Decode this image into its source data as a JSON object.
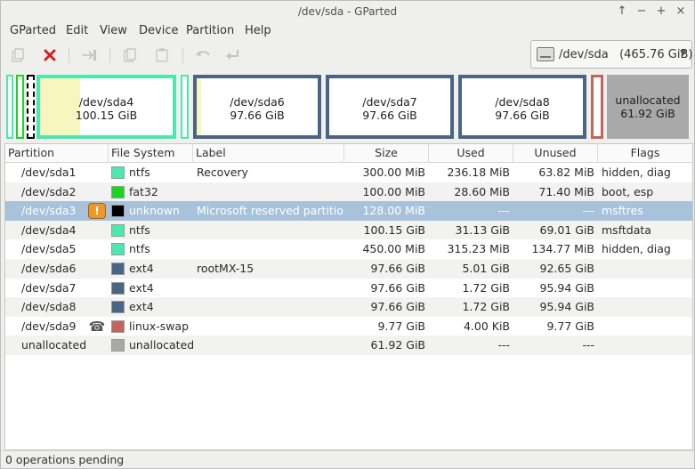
{
  "window": {
    "title": "/dev/sda - GParted"
  },
  "menu": [
    "GParted",
    "Edit",
    "View",
    "Device",
    "Partition",
    "Help"
  ],
  "toolbar": {
    "icons": [
      "new-icon",
      "delete-icon",
      "resize-move-icon",
      "copy-icon",
      "paste-icon",
      "undo-icon",
      "apply-icon"
    ]
  },
  "device_selector": {
    "label": "/dev/sda   (465.76 GiB)"
  },
  "disk_map": {
    "segments": [
      {
        "id": "sda1",
        "color": "#4ce8b0"
      },
      {
        "id": "sda2",
        "color": "#16d620"
      },
      {
        "id": "sda3",
        "color": "#000000"
      },
      {
        "id": "sda4",
        "name": "/dev/sda4",
        "size": "100.15 GiB",
        "color": "#4ce8b0"
      },
      {
        "id": "sda5",
        "color": "#4ce8b0"
      },
      {
        "id": "sda6",
        "name": "/dev/sda6",
        "size": "97.66 GiB",
        "color": "#4a6584"
      },
      {
        "id": "sda7",
        "name": "/dev/sda7",
        "size": "97.66 GiB",
        "color": "#4a6584"
      },
      {
        "id": "sda8",
        "name": "/dev/sda8",
        "size": "97.66 GiB",
        "color": "#4a6584"
      },
      {
        "id": "sda9",
        "color": "#c1665a"
      },
      {
        "id": "unallocated",
        "name": "unallocated",
        "size": "61.92 GiB",
        "color": "#a9a9a9"
      }
    ]
  },
  "table": {
    "columns": [
      "Partition",
      "File System",
      "Label",
      "Size",
      "Used",
      "Unused",
      "Flags"
    ],
    "rows": [
      {
        "partition": "/dev/sda1",
        "fs": "ntfs",
        "fs_color": "#4ce8b0",
        "label": "Recovery",
        "size": "300.00 MiB",
        "used": "236.18 MiB",
        "unused": "63.82 MiB",
        "flags": "hidden, diag"
      },
      {
        "partition": "/dev/sda2",
        "fs": "fat32",
        "fs_color": "#16d620",
        "label": "",
        "size": "100.00 MiB",
        "used": "28.60 MiB",
        "unused": "71.40 MiB",
        "flags": "boot, esp"
      },
      {
        "partition": "/dev/sda3",
        "fs": "unknown",
        "fs_color": "#000000",
        "label": "Microsoft reserved partition",
        "size": "128.00 MiB",
        "used": "---",
        "unused": "---",
        "flags": "msftres",
        "icon": "warning-icon"
      },
      {
        "partition": "/dev/sda4",
        "fs": "ntfs",
        "fs_color": "#4ce8b0",
        "label": "",
        "size": "100.15 GiB",
        "used": "31.13 GiB",
        "unused": "69.01 GiB",
        "flags": "msftdata"
      },
      {
        "partition": "/dev/sda5",
        "fs": "ntfs",
        "fs_color": "#4ce8b0",
        "label": "",
        "size": "450.00 MiB",
        "used": "315.23 MiB",
        "unused": "134.77 MiB",
        "flags": "hidden, diag"
      },
      {
        "partition": "/dev/sda6",
        "fs": "ext4",
        "fs_color": "#4a6584",
        "label": "rootMX-15",
        "size": "97.66 GiB",
        "used": "5.01 GiB",
        "unused": "92.65 GiB",
        "flags": ""
      },
      {
        "partition": "/dev/sda7",
        "fs": "ext4",
        "fs_color": "#4a6584",
        "label": "",
        "size": "97.66 GiB",
        "used": "1.72 GiB",
        "unused": "95.94 GiB",
        "flags": ""
      },
      {
        "partition": "/dev/sda8",
        "fs": "ext4",
        "fs_color": "#4a6584",
        "label": "",
        "size": "97.66 GiB",
        "used": "1.72 GiB",
        "unused": "95.94 GiB",
        "flags": ""
      },
      {
        "partition": "/dev/sda9",
        "fs": "linux-swap",
        "fs_color": "#c1665a",
        "label": "",
        "size": "9.77 GiB",
        "used": "4.00 KiB",
        "unused": "9.77 GiB",
        "flags": "",
        "icon": "lock-icon"
      },
      {
        "partition": "unallocated",
        "fs": "unallocated",
        "fs_color": "#a9a9a9",
        "label": "",
        "size": "61.92 GiB",
        "used": "---",
        "unused": "---",
        "flags": ""
      }
    ],
    "selected_index": 2
  },
  "status": {
    "text": "0 operations pending"
  }
}
